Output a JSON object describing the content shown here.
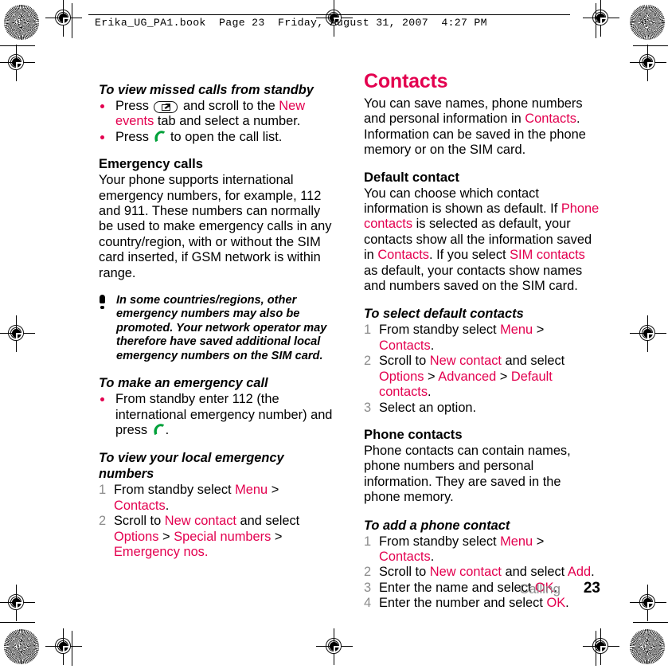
{
  "header": {
    "filename": "Erika_UG_PA1.book",
    "page_label": "Page 23",
    "date": "Friday, August 31, 2007",
    "time": "4:27 PM",
    "line": "Erika_UG_PA1.book  Page 23  Friday, August 31, 2007  4:27 PM"
  },
  "colors": {
    "accent_pink": "#e3004f",
    "list_number_gray": "#8c8c8c",
    "call_icon_green": "#00a13a",
    "text_black": "#000000"
  },
  "left_column": {
    "missed_calls": {
      "heading": "To view missed calls from standby",
      "bullets": [
        {
          "pre": "Press ",
          "icon": "activity-key-icon",
          "mid": " and scroll to the ",
          "link1": "New events",
          "post": " tab and select a number."
        },
        {
          "pre": "Press ",
          "icon": "call-icon",
          "post": " to open the call list."
        }
      ]
    },
    "emergency_calls": {
      "heading": "Emergency calls",
      "body": "Your phone supports international emergency numbers, for example, 112 and 911. These numbers can normally be used to make emergency calls in any country/region, with or without the SIM card inserted, if GSM network is within range."
    },
    "note": {
      "icon": "exclamation-icon",
      "text": "In some countries/regions, other emergency numbers may also be promoted. Your network operator may therefore have saved additional local emergency numbers on the SIM card."
    },
    "make_emergency_call": {
      "heading": "To make an emergency call",
      "bullets": [
        {
          "pre": "From standby enter 112 (the international emergency number) and press ",
          "icon": "call-icon",
          "post": "."
        }
      ]
    },
    "view_local_emergency": {
      "heading": "To view your local emergency numbers",
      "steps": [
        {
          "num": "1",
          "parts": [
            {
              "t": "From standby select ",
              "c": "black"
            },
            {
              "t": "Menu",
              "c": "pink"
            },
            {
              "t": " > ",
              "c": "black"
            },
            {
              "t": "Contacts",
              "c": "pink"
            },
            {
              "t": ".",
              "c": "black"
            }
          ]
        },
        {
          "num": "2",
          "parts": [
            {
              "t": "Scroll to ",
              "c": "black"
            },
            {
              "t": "New contact",
              "c": "pink"
            },
            {
              "t": " and select ",
              "c": "black"
            },
            {
              "t": "Options",
              "c": "pink"
            },
            {
              "t": " > ",
              "c": "black"
            },
            {
              "t": "Special numbers",
              "c": "pink"
            },
            {
              "t": " > ",
              "c": "black"
            },
            {
              "t": "Emergency nos.",
              "c": "pink"
            }
          ]
        }
      ]
    }
  },
  "right_column": {
    "title": "Contacts",
    "intro_parts": [
      {
        "t": "You can save names, phone numbers and personal information in ",
        "c": "black"
      },
      {
        "t": "Contacts",
        "c": "pink"
      },
      {
        "t": ". Information can be saved in the phone memory or on the SIM card.",
        "c": "black"
      }
    ],
    "default_contact": {
      "heading": "Default contact",
      "parts": [
        {
          "t": "You can choose which contact information is shown as default. If ",
          "c": "black"
        },
        {
          "t": "Phone contacts",
          "c": "pink"
        },
        {
          "t": " is selected as default, your contacts show all the information saved in ",
          "c": "black"
        },
        {
          "t": "Contacts",
          "c": "pink"
        },
        {
          "t": ". If you select ",
          "c": "black"
        },
        {
          "t": "SIM contacts",
          "c": "pink"
        },
        {
          "t": " as default, your contacts show names and numbers saved on the SIM card.",
          "c": "black"
        }
      ]
    },
    "select_default_contacts": {
      "heading": "To select default contacts",
      "steps": [
        {
          "num": "1",
          "parts": [
            {
              "t": "From standby select ",
              "c": "black"
            },
            {
              "t": "Menu",
              "c": "pink"
            },
            {
              "t": " > ",
              "c": "black"
            },
            {
              "t": " Contacts",
              "c": "pink"
            },
            {
              "t": ".",
              "c": "black"
            }
          ]
        },
        {
          "num": "2",
          "parts": [
            {
              "t": "Scroll to ",
              "c": "black"
            },
            {
              "t": "New contact",
              "c": "pink"
            },
            {
              "t": " and select ",
              "c": "black"
            },
            {
              "t": "Options",
              "c": "pink"
            },
            {
              "t": " > ",
              "c": "black"
            },
            {
              "t": "Advanced",
              "c": "pink"
            },
            {
              "t": " > ",
              "c": "black"
            },
            {
              "t": "Default contacts",
              "c": "pink"
            },
            {
              "t": ".",
              "c": "black"
            }
          ]
        },
        {
          "num": "3",
          "parts": [
            {
              "t": "Select an option.",
              "c": "black"
            }
          ]
        }
      ]
    },
    "phone_contacts": {
      "heading": "Phone contacts",
      "body": "Phone contacts can contain names, phone numbers and personal information. They are saved in the phone memory."
    },
    "add_phone_contact": {
      "heading": "To add a phone contact",
      "steps": [
        {
          "num": "1",
          "parts": [
            {
              "t": "From standby select ",
              "c": "black"
            },
            {
              "t": "Menu",
              "c": "pink"
            },
            {
              "t": " > ",
              "c": "black"
            },
            {
              "t": "Contacts",
              "c": "pink"
            },
            {
              "t": ".",
              "c": "black"
            }
          ]
        },
        {
          "num": "2",
          "parts": [
            {
              "t": "Scroll to ",
              "c": "black"
            },
            {
              "t": "New contact",
              "c": "pink"
            },
            {
              "t": " and select ",
              "c": "black"
            },
            {
              "t": "Add",
              "c": "pink"
            },
            {
              "t": ".",
              "c": "black"
            }
          ]
        },
        {
          "num": "3",
          "parts": [
            {
              "t": "Enter the name and select ",
              "c": "black"
            },
            {
              "t": "OK",
              "c": "pink"
            },
            {
              "t": ".",
              "c": "black"
            }
          ]
        },
        {
          "num": "4",
          "parts": [
            {
              "t": "Enter the number and select ",
              "c": "black"
            },
            {
              "t": "OK",
              "c": "pink"
            },
            {
              "t": ".",
              "c": "black"
            }
          ]
        }
      ]
    }
  },
  "footer": {
    "chapter": "Calling",
    "page_number": "23"
  }
}
